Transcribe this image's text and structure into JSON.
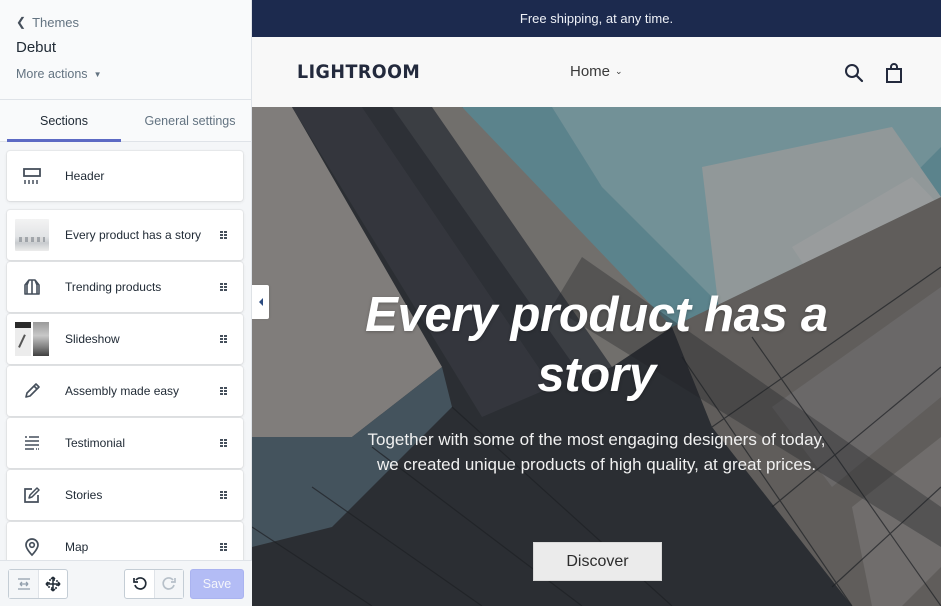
{
  "sidebar": {
    "back_label": "Themes",
    "theme_name": "Debut",
    "more_actions_label": "More actions",
    "tabs": [
      {
        "label": "Sections",
        "active": true
      },
      {
        "label": "General settings",
        "active": false
      }
    ],
    "sections": [
      {
        "label": "Header",
        "icon": "header-layout-icon",
        "draggable": false
      },
      {
        "label": "Every product has a story",
        "icon": "image-thumbnail",
        "draggable": true
      },
      {
        "label": "Trending products",
        "icon": "collection-icon",
        "draggable": true
      },
      {
        "label": "Slideshow",
        "icon": "slideshow-thumbnail",
        "draggable": true
      },
      {
        "label": "Assembly made easy",
        "icon": "pencil-icon",
        "draggable": true
      },
      {
        "label": "Testimonial",
        "icon": "text-lines-icon",
        "draggable": true
      },
      {
        "label": "Stories",
        "icon": "edit-note-icon",
        "draggable": true
      },
      {
        "label": "Map",
        "icon": "map-pin-icon",
        "draggable": true
      }
    ],
    "footer": {
      "save_label": "Save"
    }
  },
  "preview": {
    "announcement": "Free shipping, at any time.",
    "logo": "LIGHTROOM",
    "nav_home": "Home",
    "hero": {
      "title": "Every product has a story",
      "text": "Together with some of the most engaging designers of today, we created unique products of high quality, at great prices.",
      "button_label": "Discover"
    }
  },
  "colors": {
    "accent": "#5c6ac4",
    "save_disabled": "#b3bcf5",
    "announcement_bg": "#1c2a4e",
    "text_primary": "#212b36",
    "text_secondary": "#637381"
  }
}
